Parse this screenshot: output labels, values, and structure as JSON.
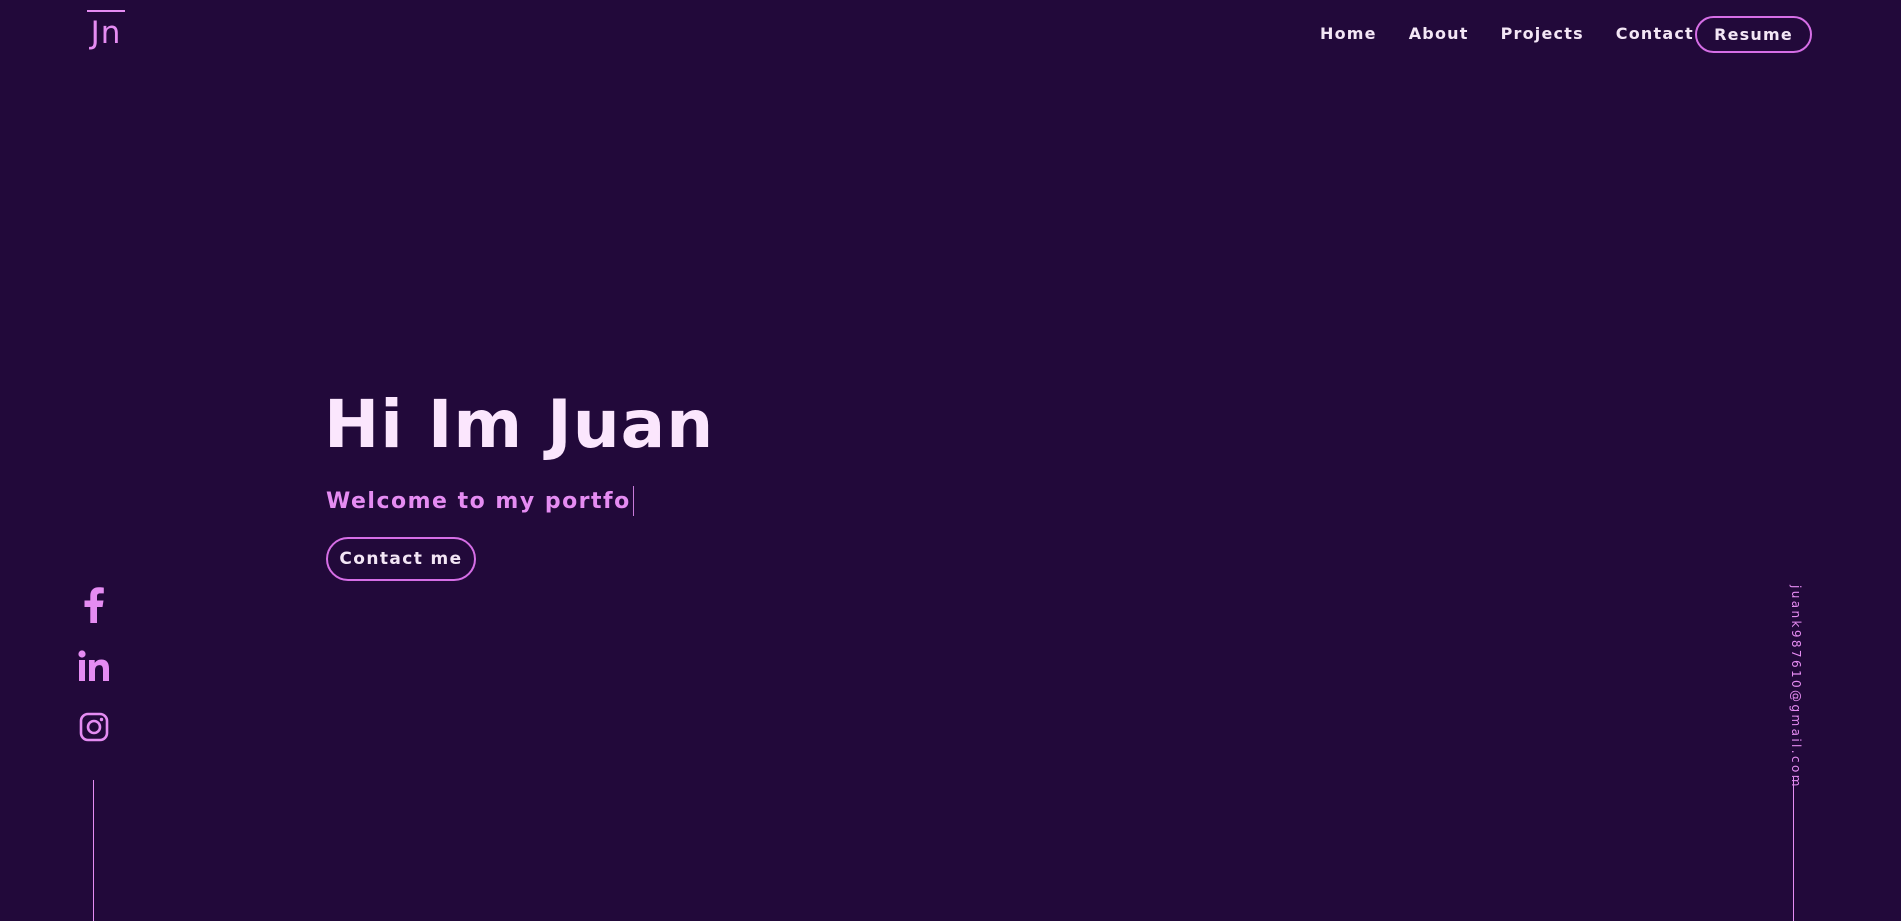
{
  "brand": {
    "logo_text": "Jn"
  },
  "nav": {
    "items": [
      {
        "label": "Home"
      },
      {
        "label": "About"
      },
      {
        "label": "Projects"
      },
      {
        "label": "Contact"
      }
    ],
    "resume_label": "Resume"
  },
  "hero": {
    "title": "Hi Im Juan",
    "subtitle_typed": "Welcome to my portfo",
    "contact_label": "Contact me"
  },
  "socials": [
    {
      "icon": "facebook-icon"
    },
    {
      "icon": "linkedin-icon"
    },
    {
      "icon": "instagram-icon"
    }
  ],
  "email": "juank987610@gmail.com",
  "colors": {
    "background": "#22093a",
    "accent": "#e58cf2",
    "button_border": "#d66ee6",
    "heading": "#fbe6fd",
    "text": "#f3e6f5"
  }
}
